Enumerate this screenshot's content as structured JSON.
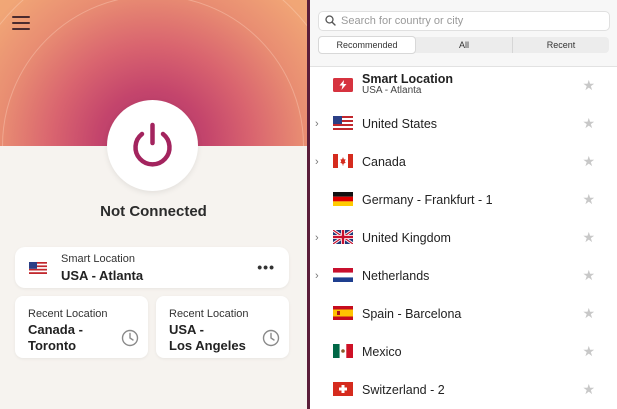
{
  "left": {
    "status": "Not Connected",
    "smart_card": {
      "label": "Smart Location",
      "location": "USA - Atlanta",
      "more": "•••"
    },
    "recent": [
      {
        "label": "Recent Location",
        "location": "Canada -\nToronto"
      },
      {
        "label": "Recent Location",
        "location": "USA -\nLos Angeles"
      }
    ]
  },
  "right": {
    "search_placeholder": "Search for country or city",
    "tabs": [
      "Recommended",
      "All",
      "Recent"
    ],
    "active_tab": "Recommended",
    "smart": {
      "name": "Smart Location",
      "sub": "USA - Atlanta"
    },
    "locations": [
      {
        "name": "United States",
        "expandable": true,
        "flag": "us"
      },
      {
        "name": "Canada",
        "expandable": true,
        "flag": "ca"
      },
      {
        "name": "Germany - Frankfurt - 1",
        "expandable": false,
        "flag": "de"
      },
      {
        "name": "United Kingdom",
        "expandable": true,
        "flag": "uk"
      },
      {
        "name": "Netherlands",
        "expandable": true,
        "flag": "nl"
      },
      {
        "name": "Spain - Barcelona",
        "expandable": false,
        "flag": "es"
      },
      {
        "name": "Mexico",
        "expandable": false,
        "flag": "mx"
      },
      {
        "name": "Switzerland - 2",
        "expandable": false,
        "flag": "ch"
      }
    ]
  },
  "colors": {
    "accent": "#a63266",
    "divider": "#5b1e3a",
    "smart_red": "#d6333f"
  }
}
